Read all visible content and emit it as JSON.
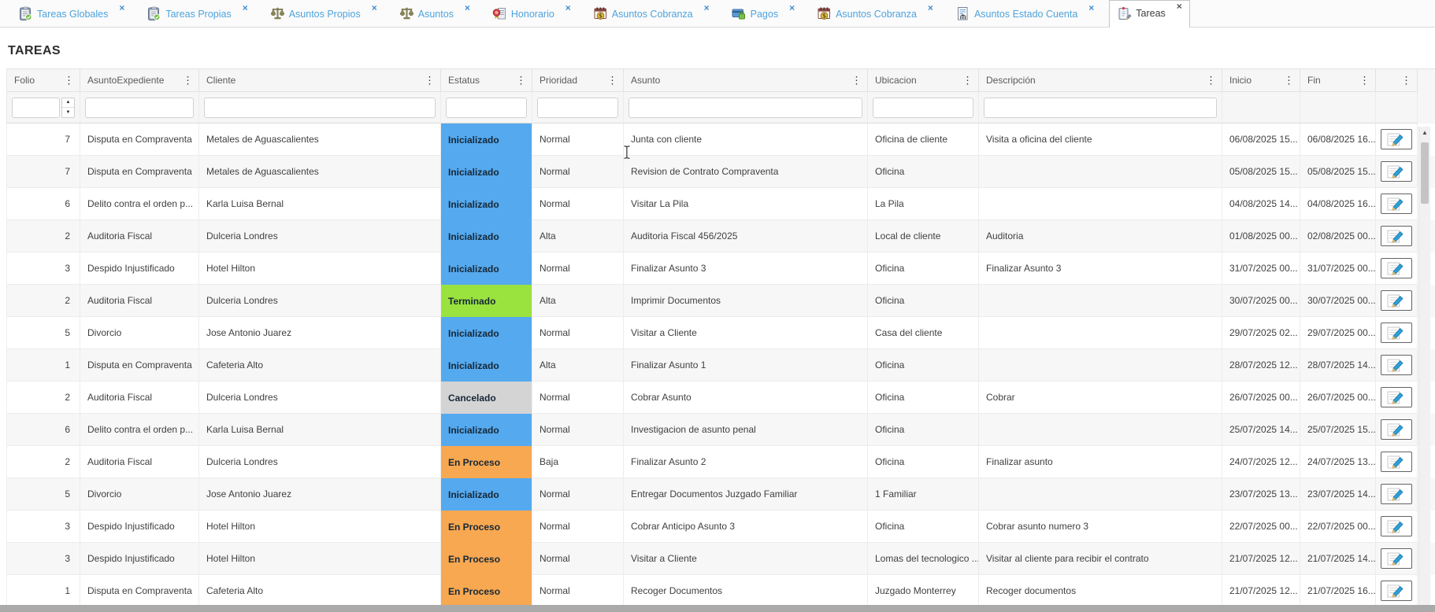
{
  "page": {
    "title": "TAREAS"
  },
  "icons": {
    "tab_close": "×",
    "column_menu": "⋮",
    "spinner_up": "▲",
    "spinner_down": "▼",
    "scroll_up": "▲"
  },
  "tabs": [
    {
      "label": "Tareas Globales",
      "icon": "clipboard-check-icon",
      "active": false
    },
    {
      "label": "Tareas Propias",
      "icon": "clipboard-check-icon",
      "active": false
    },
    {
      "label": "Asuntos Propios",
      "icon": "scales-icon",
      "active": false
    },
    {
      "label": "Asuntos",
      "icon": "scales-icon",
      "active": false
    },
    {
      "label": "Honorario",
      "icon": "seal-document-icon",
      "active": false
    },
    {
      "label": "Asuntos Cobranza",
      "icon": "calendar-coin-icon",
      "active": false
    },
    {
      "label": "Pagos",
      "icon": "card-lock-icon",
      "active": false
    },
    {
      "label": "Asuntos Cobranza",
      "icon": "calendar-coin-icon",
      "active": false
    },
    {
      "label": "Asuntos Estado Cuenta",
      "icon": "document-bank-icon",
      "active": false
    },
    {
      "label": "Tareas",
      "icon": "clipboard-task-icon",
      "active": true
    }
  ],
  "grid": {
    "columns": [
      {
        "label": "Folio"
      },
      {
        "label": "AsuntoExpediente"
      },
      {
        "label": "Cliente"
      },
      {
        "label": "Estatus"
      },
      {
        "label": "Prioridad"
      },
      {
        "label": "Asunto"
      },
      {
        "label": "Ubicacion"
      },
      {
        "label": "Descripción"
      },
      {
        "label": "Inicio"
      },
      {
        "label": "Fin"
      },
      {
        "label": ""
      }
    ],
    "status_colors": {
      "Inicializado": "#55a9ee",
      "Terminado": "#9ae23e",
      "Cancelado": "#d4d4d4",
      "En Proceso": "#f7a851"
    },
    "rows": [
      {
        "folio": "7",
        "expediente": "Disputa en Compraventa",
        "cliente": "Metales de Aguascalientes",
        "estatus": "Inicializado",
        "prioridad": "Normal",
        "asunto": "Junta con cliente",
        "ubicacion": "Oficina de cliente",
        "descripcion": "Visita a oficina del cliente",
        "inicio": "06/08/2025 15...",
        "fin": "06/08/2025 16..."
      },
      {
        "folio": "7",
        "expediente": "Disputa en Compraventa",
        "cliente": "Metales de Aguascalientes",
        "estatus": "Inicializado",
        "prioridad": "Normal",
        "asunto": "Revision de Contrato Compraventa",
        "ubicacion": "Oficina",
        "descripcion": "",
        "inicio": "05/08/2025 15...",
        "fin": "05/08/2025 15..."
      },
      {
        "folio": "6",
        "expediente": "Delito contra el orden p...",
        "cliente": "Karla Luisa Bernal",
        "estatus": "Inicializado",
        "prioridad": "Normal",
        "asunto": "Visitar La Pila",
        "ubicacion": "La Pila",
        "descripcion": "",
        "inicio": "04/08/2025 14...",
        "fin": "04/08/2025 16..."
      },
      {
        "folio": "2",
        "expediente": "Auditoria Fiscal",
        "cliente": "Dulceria Londres",
        "estatus": "Inicializado",
        "prioridad": "Alta",
        "asunto": "Auditoria Fiscal 456/2025",
        "ubicacion": "Local de cliente",
        "descripcion": "Auditoria",
        "inicio": "01/08/2025 00...",
        "fin": "02/08/2025 00..."
      },
      {
        "folio": "3",
        "expediente": "Despido Injustificado",
        "cliente": "Hotel Hilton",
        "estatus": "Inicializado",
        "prioridad": "Normal",
        "asunto": "Finalizar Asunto 3",
        "ubicacion": "Oficina",
        "descripcion": "Finalizar Asunto 3",
        "inicio": "31/07/2025 00...",
        "fin": "31/07/2025 00..."
      },
      {
        "folio": "2",
        "expediente": "Auditoria Fiscal",
        "cliente": "Dulceria Londres",
        "estatus": "Terminado",
        "prioridad": "Alta",
        "asunto": "Imprimir Documentos",
        "ubicacion": "Oficina",
        "descripcion": "",
        "inicio": "30/07/2025 00...",
        "fin": "30/07/2025 00..."
      },
      {
        "folio": "5",
        "expediente": "Divorcio",
        "cliente": "Jose Antonio Juarez",
        "estatus": "Inicializado",
        "prioridad": "Normal",
        "asunto": "Visitar a Cliente",
        "ubicacion": "Casa del cliente",
        "descripcion": "",
        "inicio": "29/07/2025 02...",
        "fin": "29/07/2025 00..."
      },
      {
        "folio": "1",
        "expediente": "Disputa en Compraventa",
        "cliente": "Cafeteria Alto",
        "estatus": "Inicializado",
        "prioridad": "Alta",
        "asunto": "Finalizar Asunto 1",
        "ubicacion": "Oficina",
        "descripcion": "",
        "inicio": "28/07/2025 12...",
        "fin": "28/07/2025 14..."
      },
      {
        "folio": "2",
        "expediente": "Auditoria Fiscal",
        "cliente": "Dulceria Londres",
        "estatus": "Cancelado",
        "prioridad": "Normal",
        "asunto": "Cobrar Asunto",
        "ubicacion": "Oficina",
        "descripcion": "Cobrar",
        "inicio": "26/07/2025 00...",
        "fin": "26/07/2025 00..."
      },
      {
        "folio": "6",
        "expediente": "Delito contra el orden p...",
        "cliente": "Karla Luisa Bernal",
        "estatus": "Inicializado",
        "prioridad": "Normal",
        "asunto": "Investigacion de asunto penal",
        "ubicacion": "Oficina",
        "descripcion": "",
        "inicio": "25/07/2025 14...",
        "fin": "25/07/2025 15..."
      },
      {
        "folio": "2",
        "expediente": "Auditoria Fiscal",
        "cliente": "Dulceria Londres",
        "estatus": "En Proceso",
        "prioridad": "Baja",
        "asunto": "Finalizar Asunto 2",
        "ubicacion": "Oficina",
        "descripcion": "Finalizar asunto",
        "inicio": "24/07/2025 12...",
        "fin": "24/07/2025 13..."
      },
      {
        "folio": "5",
        "expediente": "Divorcio",
        "cliente": "Jose Antonio Juarez",
        "estatus": "Inicializado",
        "prioridad": "Normal",
        "asunto": "Entregar Documentos Juzgado Familiar",
        "ubicacion": "1 Familiar",
        "descripcion": "",
        "inicio": "23/07/2025 13...",
        "fin": "23/07/2025 14..."
      },
      {
        "folio": "3",
        "expediente": "Despido Injustificado",
        "cliente": "Hotel Hilton",
        "estatus": "En Proceso",
        "prioridad": "Normal",
        "asunto": "Cobrar Anticipo Asunto 3",
        "ubicacion": "Oficina",
        "descripcion": "Cobrar asunto numero 3",
        "inicio": "22/07/2025 00...",
        "fin": "22/07/2025 00..."
      },
      {
        "folio": "3",
        "expediente": "Despido Injustificado",
        "cliente": "Hotel Hilton",
        "estatus": "En Proceso",
        "prioridad": "Normal",
        "asunto": "Visitar a Cliente",
        "ubicacion": "Lomas del tecnologico ...",
        "descripcion": "Visitar al cliente para recibir el contrato",
        "inicio": "21/07/2025 12...",
        "fin": "21/07/2025 14..."
      },
      {
        "folio": "1",
        "expediente": "Disputa en Compraventa",
        "cliente": "Cafeteria Alto",
        "estatus": "En Proceso",
        "prioridad": "Normal",
        "asunto": "Recoger Documentos",
        "ubicacion": "Juzgado Monterrey",
        "descripcion": "Recoger documentos",
        "inicio": "21/07/2025 12...",
        "fin": "21/07/2025 16..."
      }
    ]
  }
}
